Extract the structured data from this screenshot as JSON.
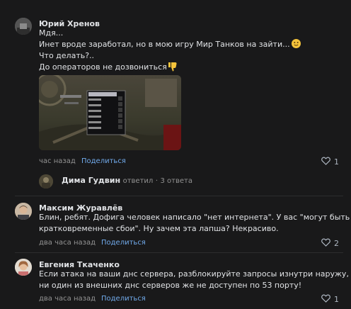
{
  "comments": [
    {
      "author": "Юрий Хренов",
      "lines": [
        "Мдя...",
        "Инет вроде заработал, но в мою игру Мир Танков на зайти...",
        "Что делать?..",
        "До операторов не дозвониться"
      ],
      "emojis": [
        "slightly-smiling-face-icon",
        "thumbs-down-icon"
      ],
      "time": "час назад",
      "share": "Поделиться",
      "likes": "1",
      "reply_thread": {
        "author": "Дима Гудвин",
        "action": "ответил",
        "separator": "·",
        "count": "3 ответа"
      }
    },
    {
      "author": "Максим Журавлёв",
      "lines": [
        "Блин, ребят. Дофига человек написало \"нет интернета\". У вас \"могут быть",
        "кратковременные сбои\". Ну зачем эта лапша? Некрасиво."
      ],
      "time": "два часа назад",
      "share": "Поделиться",
      "likes": "2"
    },
    {
      "author": "Евгения Ткаченко",
      "lines": [
        "Если атака на ваши днс сервера, разблокируйте запросы изнутри наружу, ну",
        "ни один из внешних днс серверов же не доступен по 53 порту!"
      ],
      "time": "два часа назад",
      "share": "Поделиться",
      "likes": "1"
    }
  ],
  "colors": {
    "background": "#19191a",
    "text": "#e1e3e6",
    "secondary": "#939393",
    "link": "#71aaeb",
    "emoji": "#f5c33b"
  }
}
